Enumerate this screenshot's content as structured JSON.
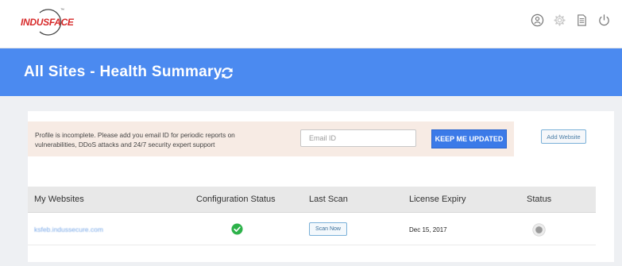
{
  "header": {
    "logo_text": "INDUSFACE",
    "logo_tm": "™",
    "icons": [
      "user-icon",
      "gear-icon",
      "document-icon",
      "power-icon"
    ]
  },
  "banner": {
    "title": "All Sites - Health Summary",
    "refresh_icon": "refresh-icon"
  },
  "notice": {
    "text": "Profile is incomplete. Please add you email ID for periodic reports on vulnerabilities, DDoS attacks and 24/7 security expert support",
    "email_placeholder": "Email ID",
    "email_value": "",
    "keep_button": "KEEP ME UPDATED",
    "add_website_button": "Add Website"
  },
  "table": {
    "columns": [
      "My Websites",
      "Configuration Status",
      "Last Scan",
      "License Expiry",
      "Status"
    ],
    "rows": [
      {
        "website": "ksfeb.indussecure.com",
        "configuration_icon": "check-circle-icon",
        "last_scan_button": "Scan Now",
        "license_expiry": "Dec 15, 2017",
        "status_icon": "status-dot-icon"
      }
    ]
  },
  "colors": {
    "banner": "#4b8af0",
    "primary_button": "#3b7ae8",
    "success": "#2db24a",
    "logo_red": "#d72a2a",
    "notice_bg": "#f7ebe4"
  }
}
